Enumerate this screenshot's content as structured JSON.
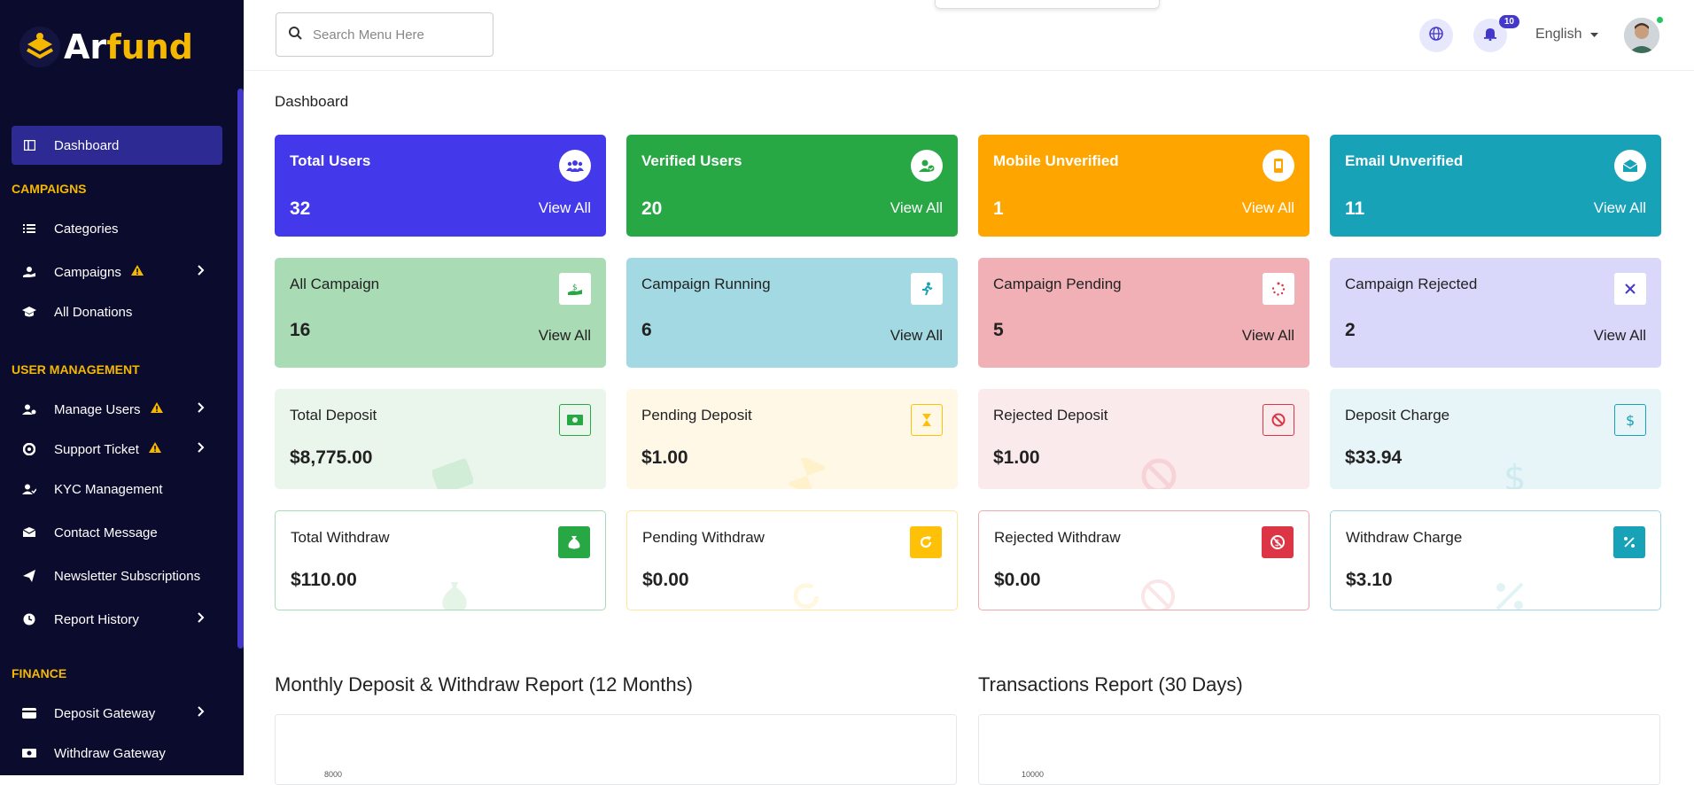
{
  "brand": {
    "part1": "Ar",
    "part2": "fund"
  },
  "search": {
    "placeholder": "Search Menu Here"
  },
  "topbar": {
    "notifications_count": "10",
    "language": "English"
  },
  "sidebar": {
    "dashboard": "Dashboard",
    "sections": {
      "campaigns": "CAMPAIGNS",
      "user_management": "USER MANAGEMENT",
      "finance": "FINANCE"
    },
    "items": {
      "categories": "Categories",
      "campaigns": "Campaigns",
      "all_donations": "All Donations",
      "manage_users": "Manage Users",
      "support_ticket": "Support Ticket",
      "kyc": "KYC Management",
      "contact": "Contact Message",
      "newsletter": "Newsletter Subscriptions",
      "report_history": "Report History",
      "deposit_gateway": "Deposit Gateway",
      "withdraw_gateway": "Withdraw Gateway"
    }
  },
  "page_title": "Dashboard",
  "view_all": "View All",
  "cards": {
    "total_users": {
      "label": "Total Users",
      "value": "32",
      "bg": "#4338ea"
    },
    "verified_users": {
      "label": "Verified Users",
      "value": "20",
      "bg": "#28a745"
    },
    "mobile_unverified": {
      "label": "Mobile Unverified",
      "value": "1",
      "bg": "#ffa500"
    },
    "email_unverified": {
      "label": "Email Unverified",
      "value": "11",
      "bg": "#17a2b8"
    },
    "all_campaign": {
      "label": "All Campaign",
      "value": "16",
      "bg": "#a9dbb4"
    },
    "campaign_running": {
      "label": "Campaign Running",
      "value": "6",
      "bg": "#a2d9e2"
    },
    "campaign_pending": {
      "label": "Campaign Pending",
      "value": "5",
      "bg": "#f0b0b5"
    },
    "campaign_rejected": {
      "label": "Campaign Rejected",
      "value": "2",
      "bg": "#d9d8fb"
    },
    "total_deposit": {
      "label": "Total Deposit",
      "value": "$8,775.00",
      "bg": "#eaf6ec"
    },
    "pending_deposit": {
      "label": "Pending Deposit",
      "value": "$1.00",
      "bg": "#fff8e6"
    },
    "rejected_deposit": {
      "label": "Rejected Deposit",
      "value": "$1.00",
      "bg": "#fbeaec"
    },
    "deposit_charge": {
      "label": "Deposit Charge",
      "value": "$33.94",
      "bg": "#e7f5f8"
    },
    "total_withdraw": {
      "label": "Total Withdraw",
      "value": "$110.00",
      "accent": "#28a745"
    },
    "pending_withdraw": {
      "label": "Pending Withdraw",
      "value": "$0.00",
      "accent": "#ffc107"
    },
    "rejected_withdraw": {
      "label": "Rejected Withdraw",
      "value": "$0.00",
      "accent": "#dc3545"
    },
    "withdraw_charge": {
      "label": "Withdraw Charge",
      "value": "$3.10",
      "accent": "#17a2b8"
    }
  },
  "reports": {
    "monthly": {
      "title": "Monthly Deposit & Withdraw Report (12 Months)",
      "tick": "8000"
    },
    "transactions": {
      "title": "Transactions Report (30 Days)",
      "tick": "10000"
    }
  },
  "colors": {
    "sidebar_bg": "#0b0b2e",
    "accent": "#4338ca",
    "section": "#f5b800"
  }
}
